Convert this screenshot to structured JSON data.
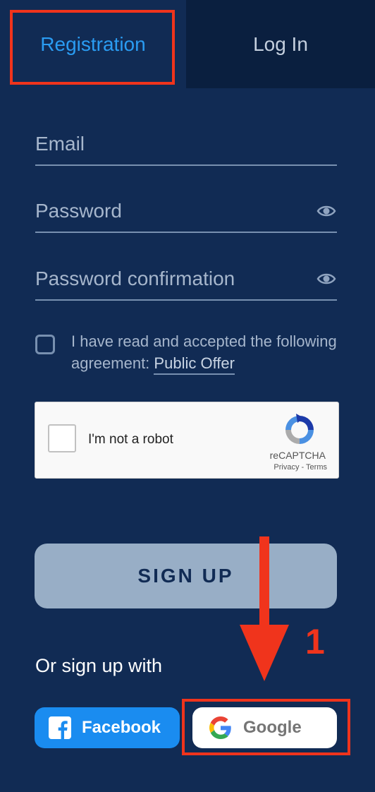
{
  "tabs": {
    "registration": "Registration",
    "login": "Log In"
  },
  "form": {
    "email_placeholder": "Email",
    "password_placeholder": "Password",
    "password_confirm_placeholder": "Password confirmation",
    "agreement_text": "I have read and accepted the following agreement:",
    "agreement_link": "Public Offer"
  },
  "recaptcha": {
    "label": "I'm not a robot",
    "brand": "reCAPTCHA",
    "privacy": "Privacy",
    "separator": "-",
    "terms": "Terms"
  },
  "signup_button": "SIGN UP",
  "social": {
    "heading": "Or sign up with",
    "facebook": "Facebook",
    "google": "Google"
  },
  "annotation": {
    "step_number": "1"
  },
  "colors": {
    "background": "#112b54",
    "active_tab_text": "#2a9cf2",
    "facebook": "#1a8cf0",
    "signup_button": "#98aec6",
    "annotation": "#f0341c"
  }
}
